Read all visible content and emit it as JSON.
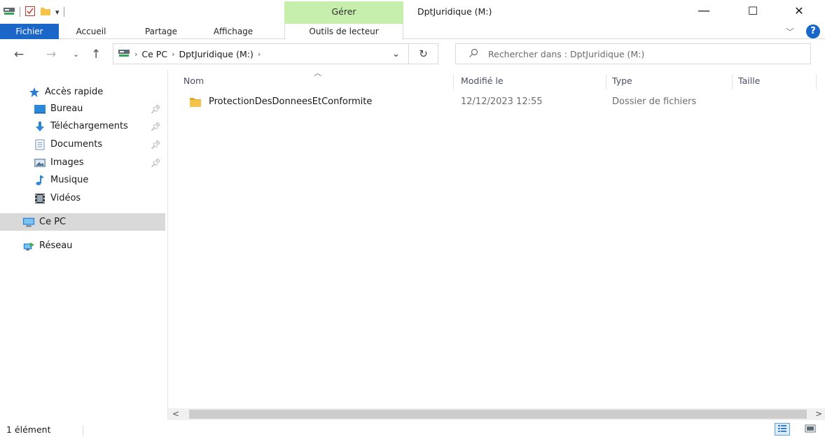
{
  "window": {
    "title": "DptJuridique (M:)",
    "context_tab": "Gérer",
    "minimize": "—",
    "maximize": "☐",
    "close": "✕"
  },
  "ribbon": {
    "tabs": [
      "Fichier",
      "Accueil",
      "Partage",
      "Affichage",
      "Outils de lecteur"
    ],
    "expand_icon": "chevron-down-icon",
    "help_icon": "help-icon"
  },
  "address": {
    "crumbs": [
      "Ce PC",
      "DptJuridique (M:)"
    ],
    "search_placeholder": "Rechercher dans : DptJuridique (M:)"
  },
  "nav": {
    "quick_access": "Accès rapide",
    "items": [
      {
        "label": "Bureau",
        "icon": "desktop-icon",
        "pinned": true
      },
      {
        "label": "Téléchargements",
        "icon": "download-icon",
        "pinned": true
      },
      {
        "label": "Documents",
        "icon": "documents-icon",
        "pinned": true
      },
      {
        "label": "Images",
        "icon": "images-icon",
        "pinned": true
      },
      {
        "label": "Musique",
        "icon": "music-icon",
        "pinned": false
      },
      {
        "label": "Vidéos",
        "icon": "videos-icon",
        "pinned": false
      }
    ],
    "this_pc": "Ce PC",
    "network": "Réseau"
  },
  "columns": [
    "Nom",
    "Modifié le",
    "Type",
    "Taille"
  ],
  "files": [
    {
      "name": "ProtectionDesDonneesEtConformite",
      "modified": "12/12/2023 12:55",
      "type": "Dossier de fichiers",
      "size": ""
    }
  ],
  "status": {
    "count": "1 élément"
  },
  "colors": {
    "file_tab": "#1b66c9",
    "manage_tab": "#c6efae",
    "folder": "#f5c24a",
    "selection": "#d9d9d9"
  }
}
